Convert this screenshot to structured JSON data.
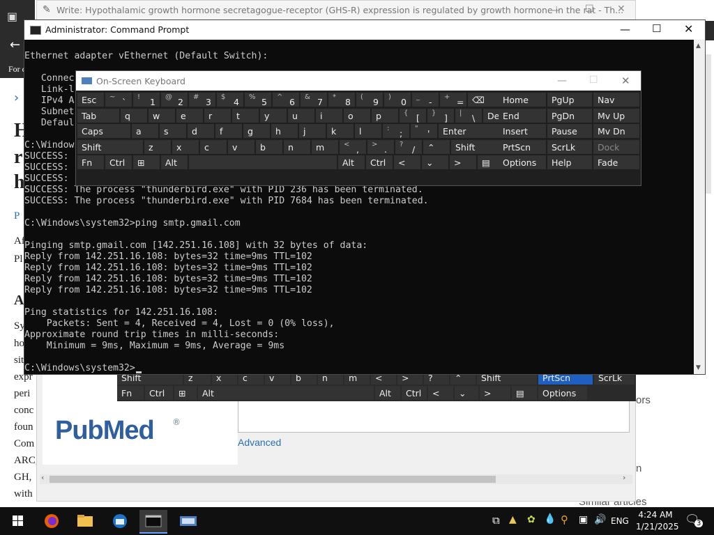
{
  "background": {
    "browser_title": "Write: Hypothalamic growth hormone secretagogue-receptor (GHS-R) expression is regulated by growth hormone in the rat - Th...",
    "left_rail": [
      "For c",
      "H",
      "r",
      "h",
      "P",
      "Af",
      "Pl",
      "A",
      "Sy",
      "ho",
      "sit",
      "expr",
      "peri",
      "conc",
      "foun",
      "Com",
      "ARC,",
      "GH,",
      "with"
    ],
    "pubmed_logo": "PubMed",
    "advanced_link": "Advanced",
    "right_text_ors": "ors",
    "right_text_n": "n",
    "similar_articles": "Similar articles"
  },
  "cmd": {
    "title": "Administrator: Command Prompt",
    "lines": [
      "Ethernet adapter vEthernet (Default Switch):",
      "",
      "   Connec",
      "   Link-l",
      "   IPv4 A",
      "   Subnet",
      "   Defaul",
      "",
      "C:\\Windows",
      "SUCCESS: ",
      "SUCCESS: ",
      "SUCCESS: ",
      "SUCCESS: The process \"thunderbird.exe\" with PID 236 has been terminated.",
      "SUCCESS: The process \"thunderbird.exe\" with PID 7684 has been terminated.",
      "",
      "C:\\Windows\\system32>ping smtp.gmail.com",
      "",
      "Pinging smtp.gmail.com [142.251.16.108] with 32 bytes of data:",
      "Reply from 142.251.16.108: bytes=32 time=9ms TTL=102",
      "Reply from 142.251.16.108: bytes=32 time=9ms TTL=102",
      "Reply from 142.251.16.108: bytes=32 time=9ms TTL=102",
      "Reply from 142.251.16.108: bytes=32 time=9ms TTL=102",
      "",
      "Ping statistics for 142.251.16.108:",
      "    Packets: Sent = 4, Received = 4, Lost = 0 (0% loss),",
      "Approximate round trip times in milli-seconds:",
      "    Minimum = 9ms, Maximum = 9ms, Average = 9ms",
      "",
      "C:\\Windows\\system32>"
    ]
  },
  "osk": {
    "title": "On-Screen Keyboard",
    "rows": [
      [
        {
          "l": "Esc"
        },
        {
          "s": "~",
          "m": "`"
        },
        {
          "s": "!",
          "m": "1"
        },
        {
          "s": "@",
          "m": "2"
        },
        {
          "s": "#",
          "m": "3"
        },
        {
          "s": "$",
          "m": "4"
        },
        {
          "s": "%",
          "m": "5"
        },
        {
          "s": "^",
          "m": "6"
        },
        {
          "s": "&",
          "m": "7"
        },
        {
          "s": "*",
          "m": "8"
        },
        {
          "s": "(",
          "m": "9"
        },
        {
          "s": ")",
          "m": "0"
        },
        {
          "s": "_",
          "m": "-"
        },
        {
          "s": "+",
          "m": "="
        },
        {
          "l": "⌫"
        }
      ],
      [
        {
          "l": "Tab"
        },
        {
          "l": "q"
        },
        {
          "l": "w"
        },
        {
          "l": "e"
        },
        {
          "l": "r"
        },
        {
          "l": "t"
        },
        {
          "l": "y"
        },
        {
          "l": "u"
        },
        {
          "l": "i"
        },
        {
          "l": "o"
        },
        {
          "l": "p"
        },
        {
          "s": "{",
          "m": "["
        },
        {
          "s": "}",
          "m": "]"
        },
        {
          "s": "|",
          "m": "\\"
        },
        {
          "l": "Del"
        }
      ],
      [
        {
          "l": "Caps"
        },
        {
          "l": "a"
        },
        {
          "l": "s"
        },
        {
          "l": "d"
        },
        {
          "l": "f"
        },
        {
          "l": "g"
        },
        {
          "l": "h"
        },
        {
          "l": "j"
        },
        {
          "l": "k"
        },
        {
          "l": "l"
        },
        {
          "s": ":",
          "m": ";"
        },
        {
          "s": "\"",
          "m": "'"
        },
        {
          "l": "Enter"
        }
      ],
      [
        {
          "l": "Shift"
        },
        {
          "l": "z"
        },
        {
          "l": "x"
        },
        {
          "l": "c"
        },
        {
          "l": "v"
        },
        {
          "l": "b"
        },
        {
          "l": "n"
        },
        {
          "l": "m"
        },
        {
          "s": "<",
          "m": ","
        },
        {
          "s": ">",
          "m": "."
        },
        {
          "s": "?",
          "m": "/"
        },
        {
          "l": "⌃"
        },
        {
          "l": "Shift"
        }
      ],
      [
        {
          "l": "Fn"
        },
        {
          "l": "Ctrl"
        },
        {
          "l": "⊞"
        },
        {
          "l": "Alt"
        },
        {
          "l": ""
        },
        {
          "l": "Alt"
        },
        {
          "l": "Ctrl"
        },
        {
          "l": "<"
        },
        {
          "l": "⌄"
        },
        {
          "l": ">"
        },
        {
          "l": "▤"
        }
      ]
    ],
    "nav_cols": [
      [
        "Home",
        "End",
        "Insert",
        "PrtScn",
        "Options"
      ],
      [
        "PgUp",
        "PgDn",
        "Pause",
        "ScrLk",
        "Help"
      ],
      [
        "Nav",
        "Mv Up",
        "Mv Dn",
        "Dock",
        "Fade"
      ]
    ]
  },
  "osk_lower": {
    "row1": [
      "Shift",
      "z",
      "x",
      "c",
      "v",
      "b",
      "n",
      "m",
      "<",
      ">",
      "?",
      "⌃",
      "Shift",
      "PrtScn",
      "ScrLk"
    ],
    "row2": [
      "Fn",
      "Ctrl",
      "⊞",
      "Alt",
      "Alt",
      "Ctrl",
      "<",
      "⌄",
      ">",
      "▤",
      "Options"
    ]
  },
  "taskbar": {
    "lang": "ENG",
    "time": "4:24 AM",
    "date": "1/21/2025",
    "notification_count": "3"
  }
}
